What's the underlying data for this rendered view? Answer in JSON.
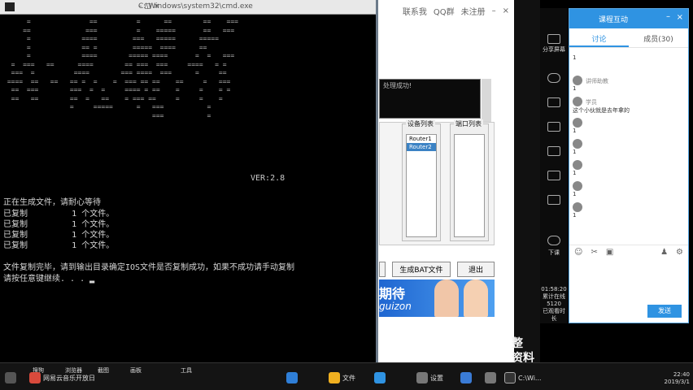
{
  "console": {
    "title": "C:\\Windows\\system32\\cmd.exe",
    "controls": "–  □  ×",
    "ascii_art": "      =               ==          =      ==        ==    ===\n     ==              ===          =    =====       ==   ===\n      =             ====         ===   =====      =====\n      =             == =         =====  ====      ==\n      =             ====        ===== ====       =  =   ===\n  =  ===   ==      ====        == ===  ===     ====   = =\n  ===  =          ====        === ====  ===      =     ==\n ====  ==   ==   == =  =    =  === == ==    ==     =   ===\n  ==  ===        ===  =  =     ==== = ==    =     =    = =\n  ==   ==        ==  =   ==    = === ==     =     =    =\n                 =     =====      =   ===           =\n                                      ===           =",
    "version": "VER:2.8",
    "lines": [
      "正在生成文件，请耐心等待",
      "已复制         1 个文件。",
      "已复制         1 个文件。",
      "已复制         1 个文件。",
      "已复制         1 个文件。",
      "文件复制完毕，请到输出目录确定IOS文件是否复制成功，如果不成功请手动复制",
      "请按任意键继续. . . ▂"
    ]
  },
  "bgwin": {
    "top_menu": [
      "联系我",
      "QQ群",
      "未注册"
    ],
    "status_text": "处理成功!",
    "device_list_caption": "设备列表",
    "devices": [
      "Router1",
      "Router2"
    ],
    "port_list_caption": "端口列表",
    "buttons": [
      "生成BAT文件",
      "退出"
    ],
    "banner_text": "期待",
    "banner_sub": "guizon"
  },
  "edge_text": [
    "整",
    "资料"
  ],
  "chat": {
    "title": "课程互动",
    "tabs": [
      "讨论",
      "成员(30)"
    ],
    "messages": [
      {
        "name": "",
        "text": "1"
      },
      {
        "name": "讲师助教",
        "text": "1"
      },
      {
        "name": "学员",
        "text": "这个小伙就是去年拿的"
      },
      {
        "name": "",
        "text": "1"
      },
      {
        "name": "",
        "text": "1"
      },
      {
        "name": "",
        "text": "1"
      },
      {
        "name": "",
        "text": "1"
      },
      {
        "name": "",
        "text": "1"
      }
    ],
    "send_label": "发送"
  },
  "sidebar_left": {
    "labels": [
      "分享屏幕",
      "下课"
    ],
    "clock": [
      "01:58:20",
      "累计在线",
      "5120",
      "已观看时长"
    ]
  },
  "taskbar": {
    "top_items": [
      "搜狗",
      "浏览器",
      "截图",
      "画板",
      "工具"
    ],
    "items": [
      {
        "label": "网易云音乐开放日",
        "color": "#d84a3c"
      },
      {
        "label": "",
        "color": "#2f7fd8"
      },
      {
        "label": "文件",
        "color": "#f0b020"
      },
      {
        "label": "",
        "color": "#2f93e2"
      },
      {
        "label": "设置",
        "color": "#777777"
      },
      {
        "label": "",
        "color": "#3a7bd5"
      },
      {
        "label": "",
        "color": "#777777"
      },
      {
        "label": "C:\\Wi...",
        "color": "#333333"
      }
    ],
    "time": [
      "22:40",
      "2019/3/1"
    ]
  }
}
